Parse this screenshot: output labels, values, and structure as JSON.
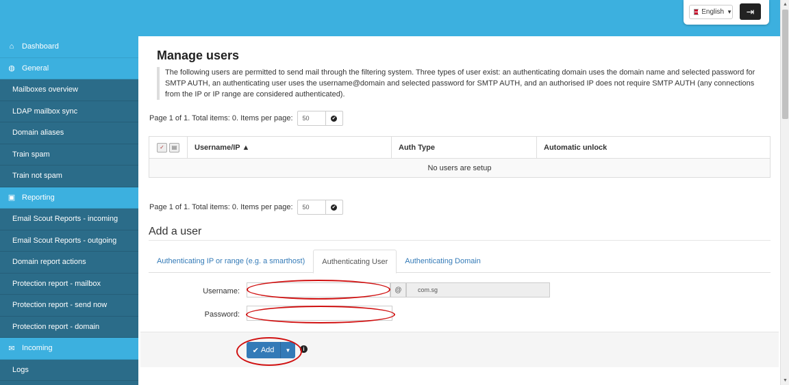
{
  "header": {
    "language_label": "English",
    "language_flag": "uk-flag-icon",
    "logout_icon": "sign-out-icon",
    "accent": "#3cb0df"
  },
  "sidebar": {
    "items": [
      {
        "label": "Dashboard",
        "section": true,
        "icon": "home-icon"
      },
      {
        "label": "General",
        "section": true,
        "icon": "globe-icon"
      },
      {
        "label": "Mailboxes overview"
      },
      {
        "label": "LDAP mailbox sync"
      },
      {
        "label": "Domain aliases"
      },
      {
        "label": "Train spam"
      },
      {
        "label": "Train not spam"
      },
      {
        "label": "Reporting",
        "section": true,
        "icon": "inbox-icon"
      },
      {
        "label": "Email Scout Reports - incoming"
      },
      {
        "label": "Email Scout Reports - outgoing"
      },
      {
        "label": "Domain report actions"
      },
      {
        "label": "Protection report - mailbox"
      },
      {
        "label": "Protection report - send now"
      },
      {
        "label": "Protection report - domain"
      },
      {
        "label": "Incoming",
        "section": true,
        "icon": "envelope-icon"
      },
      {
        "label": "Logs"
      }
    ]
  },
  "main": {
    "title": "Manage users",
    "description": "The following users are permitted to send mail through the filtering system. Three types of user exist: an authenticating domain uses the domain name and selected password for SMTP AUTH, an authenticating user uses the username@domain and selected password for SMTP AUTH, and an authorised IP does not require SMTP AUTH (any connections from the IP or IP range are considered authenticated).",
    "pager_text": "Page 1 of 1. Total items: 0. Items per page:",
    "per_page": "50",
    "table": {
      "columns": [
        "Username/IP ▲",
        "Auth Type",
        "Automatic unlock"
      ],
      "empty_text": "No users are setup"
    },
    "add_title": "Add a user",
    "tabs": [
      {
        "label": "Authenticating IP or range (e.g. a smarthost)",
        "active": false
      },
      {
        "label": "Authenticating User",
        "active": true
      },
      {
        "label": "Authenticating Domain",
        "active": false
      }
    ],
    "form": {
      "username_label": "Username:",
      "password_label": "Password:",
      "at_symbol": "@",
      "domain_value": "com.sg",
      "username_value": "",
      "password_value": ""
    },
    "add_button": "Add"
  }
}
